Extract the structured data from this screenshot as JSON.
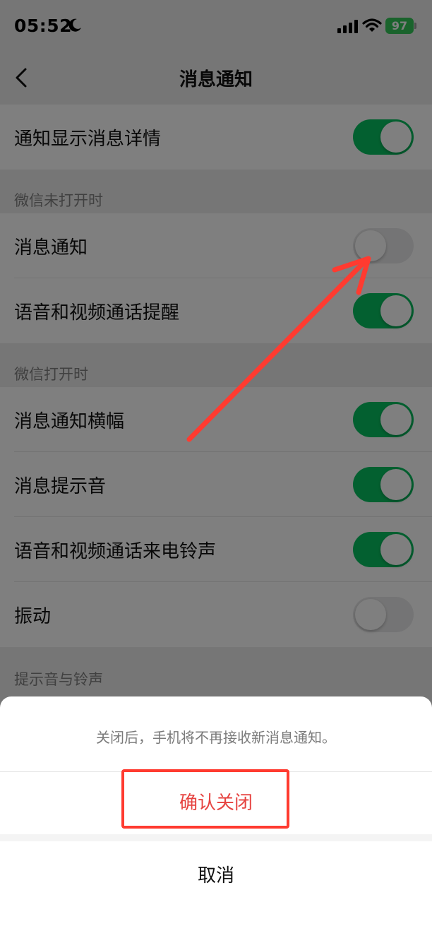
{
  "status_bar": {
    "time": "05:52",
    "battery": "97",
    "icons": [
      "moon-icon",
      "signal-icon",
      "wifi-icon",
      "battery-charging-icon"
    ]
  },
  "nav": {
    "title": "消息通知",
    "back_icon": "chevron-left-icon"
  },
  "settings": {
    "show_details": {
      "label": "通知显示消息详情",
      "on": true
    },
    "section_closed": "微信未打开时",
    "closed_items": [
      {
        "label": "消息通知",
        "on": false
      },
      {
        "label": "语音和视频通话提醒",
        "on": true
      }
    ],
    "section_open": "微信打开时",
    "open_items": [
      {
        "label": "消息通知横幅",
        "on": true
      },
      {
        "label": "消息提示音",
        "on": true
      },
      {
        "label": "语音和视频通话来电铃声",
        "on": true
      },
      {
        "label": "振动",
        "on": false
      }
    ],
    "section_sound": "提示音与铃声"
  },
  "sheet": {
    "message": "关闭后，手机将不再接收新消息通知。",
    "confirm_label": "确认关闭",
    "cancel_label": "取消"
  },
  "colors": {
    "toggle_on": "#07c160",
    "destructive": "#e64340",
    "annotation": "#ff3b30"
  }
}
